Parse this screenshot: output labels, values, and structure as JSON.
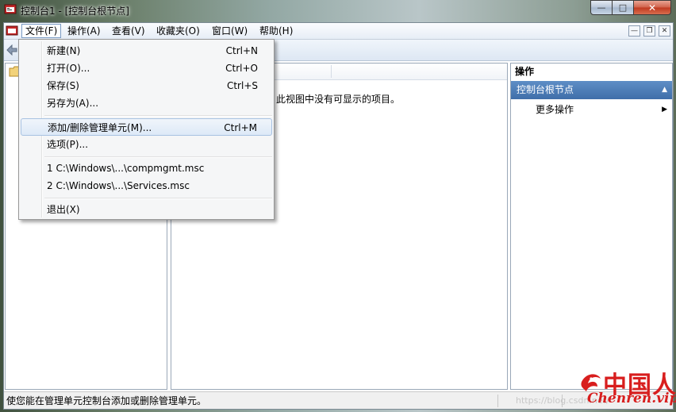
{
  "window": {
    "title": "控制台1 - [控制台根节点]",
    "caption_buttons": {
      "minimize": "—",
      "maximize": "□",
      "close": "✕"
    }
  },
  "menubar": {
    "items": [
      "文件(F)",
      "操作(A)",
      "查看(V)",
      "收藏夹(O)",
      "窗口(W)",
      "帮助(H)"
    ],
    "active": "文件(F)",
    "mdi_buttons": {
      "minimize": "—",
      "restore": "❐",
      "close": "✕"
    }
  },
  "file_menu": {
    "items": [
      {
        "label": "新建(N)",
        "shortcut": "Ctrl+N"
      },
      {
        "label": "打开(O)...",
        "shortcut": "Ctrl+O"
      },
      {
        "label": "保存(S)",
        "shortcut": "Ctrl+S"
      },
      {
        "label": "另存为(A)...",
        "shortcut": ""
      },
      {
        "label": "添加/删除管理单元(M)...",
        "shortcut": "Ctrl+M"
      },
      {
        "label": "选项(P)...",
        "shortcut": ""
      },
      {
        "label": "1 C:\\Windows\\...\\compmgmt.msc",
        "shortcut": ""
      },
      {
        "label": "2 C:\\Windows\\...\\Services.msc",
        "shortcut": ""
      },
      {
        "label": "退出(X)",
        "shortcut": ""
      }
    ],
    "highlighted": "添加/删除管理单元(M)..."
  },
  "center": {
    "empty_message": "此视图中没有可显示的项目。"
  },
  "actions": {
    "header": "操作",
    "section": "控制台根节点",
    "more": "更多操作",
    "collapse_glyph": "▲",
    "more_glyph": "▶"
  },
  "statusbar": {
    "text": "使您能在管理单元控制台添加或删除管理单元。"
  },
  "watermark": {
    "text": "https://blog.csdn.net/",
    "logo_title": "中国人",
    "logo_sub": "Chenren.vip"
  },
  "colors": {
    "selection_blue": "#3f6ea9",
    "logo_red": "#d81e1e"
  }
}
